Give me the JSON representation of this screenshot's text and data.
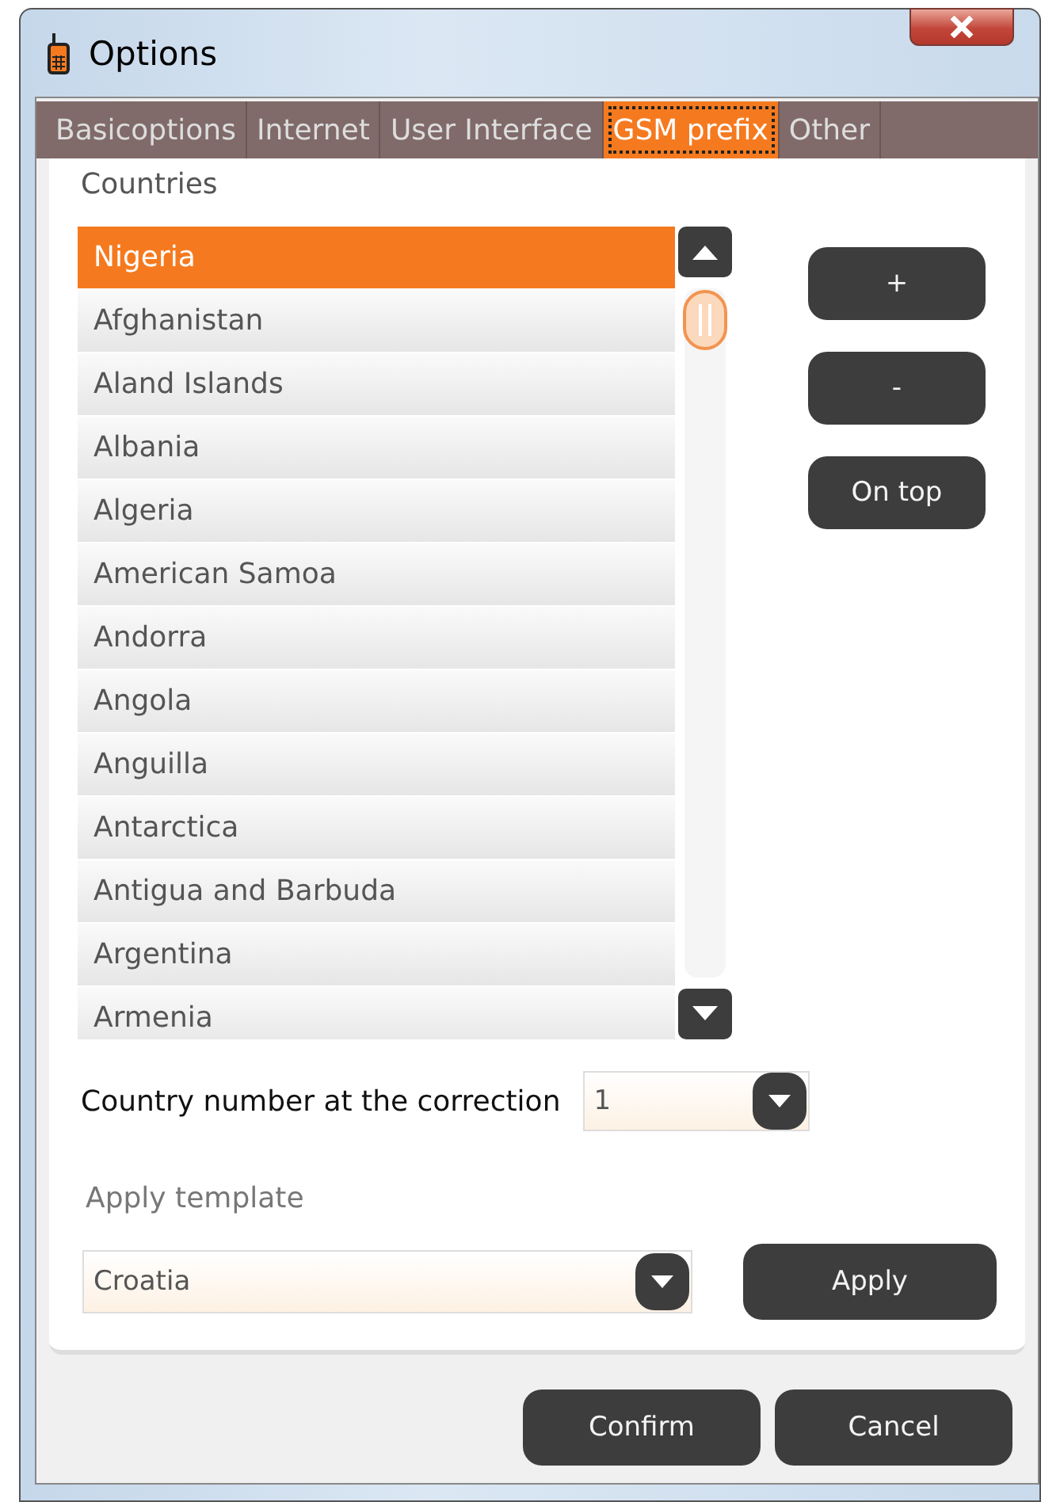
{
  "window": {
    "title": "Options"
  },
  "tabs": [
    {
      "label": "Basicoptions",
      "selected": false
    },
    {
      "label": "Internet",
      "selected": false
    },
    {
      "label": "User Interface",
      "selected": false
    },
    {
      "label": "GSM prefix",
      "selected": true
    },
    {
      "label": "Other",
      "selected": false
    }
  ],
  "countries": {
    "title": "Countries",
    "items": [
      {
        "label": "Nigeria",
        "selected": true
      },
      {
        "label": "Afghanistan",
        "selected": false
      },
      {
        "label": "Aland Islands",
        "selected": false
      },
      {
        "label": "Albania",
        "selected": false
      },
      {
        "label": "Algeria",
        "selected": false
      },
      {
        "label": "American Samoa",
        "selected": false
      },
      {
        "label": "Andorra",
        "selected": false
      },
      {
        "label": "Angola",
        "selected": false
      },
      {
        "label": "Anguilla",
        "selected": false
      },
      {
        "label": "Antarctica",
        "selected": false
      },
      {
        "label": "Antigua and Barbuda",
        "selected": false
      },
      {
        "label": "Argentina",
        "selected": false
      },
      {
        "label": "Armenia",
        "selected": false
      }
    ],
    "buttons": [
      "+",
      "-",
      "On top"
    ]
  },
  "country_number": {
    "label": "Country number at the correction",
    "value": "1"
  },
  "template": {
    "label": "Apply template",
    "value": "Croatia",
    "button": "Apply"
  },
  "footer_buttons": [
    "Confirm",
    "Cancel"
  ]
}
